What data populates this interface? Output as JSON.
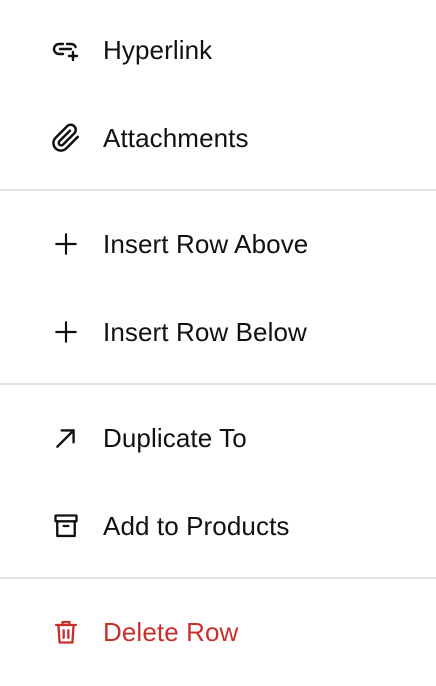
{
  "menu": {
    "items": [
      {
        "label": "Hyperlink",
        "icon": "link-plus-icon"
      },
      {
        "label": "Attachments",
        "icon": "paperclip-icon"
      },
      {
        "label": "Insert Row Above",
        "icon": "plus-icon"
      },
      {
        "label": "Insert Row Below",
        "icon": "plus-icon"
      },
      {
        "label": "Duplicate To",
        "icon": "arrow-up-right-icon"
      },
      {
        "label": "Add to Products",
        "icon": "archive-box-icon"
      },
      {
        "label": "Delete Row",
        "icon": "trash-icon"
      }
    ]
  },
  "colors": {
    "text": "#111111",
    "danger": "#c8302c",
    "divider": "#e4e4e4",
    "background": "#ffffff"
  }
}
